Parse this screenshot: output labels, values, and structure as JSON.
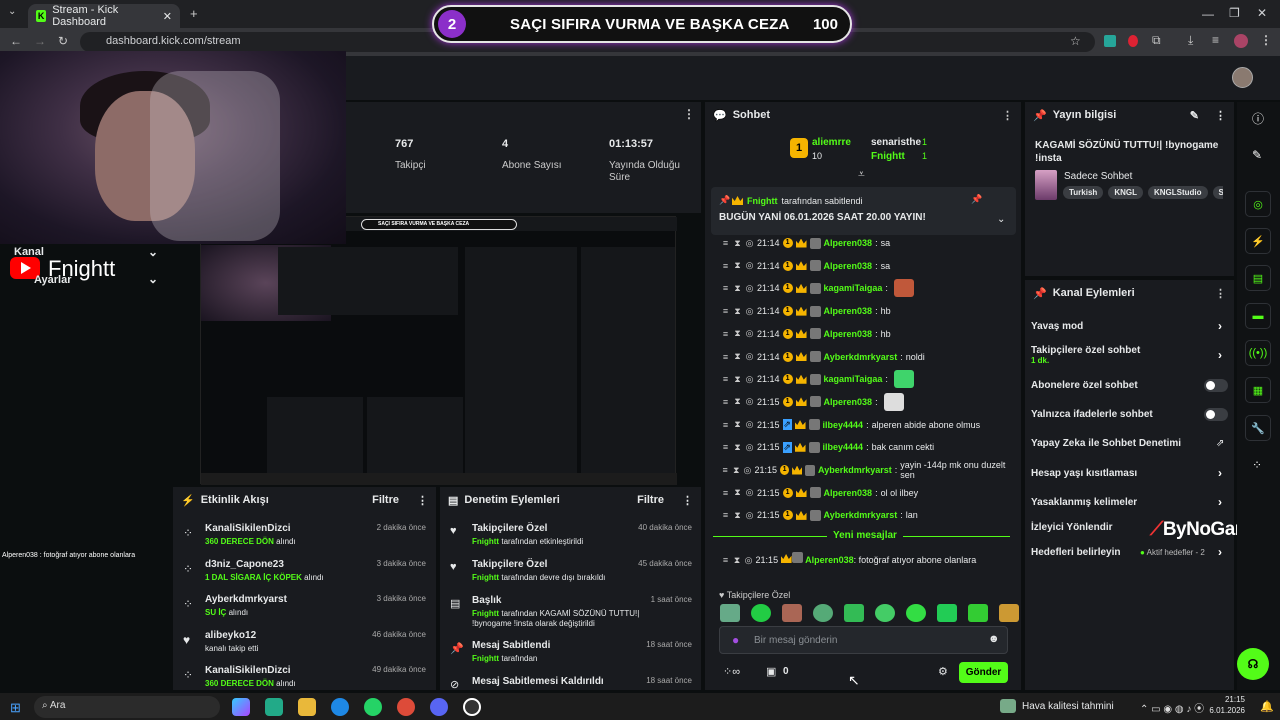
{
  "browser": {
    "tab_title": "Stream - Kick Dashboard",
    "url": "dashboard.kick.com/stream"
  },
  "banner": {
    "number": "2",
    "text": "SAÇI SIFIRA VURMA VE BAŞKA CEZA",
    "value": "100"
  },
  "stats": [
    {
      "value": "767",
      "label": "Takipçi"
    },
    {
      "value": "4",
      "label": "Abone Sayısı"
    },
    {
      "value": "01:13:57",
      "label": "Yayında Olduğu Süre"
    }
  ],
  "overlay": {
    "kanal": "Kanal",
    "ayarlar": "Ayarlar",
    "name": "Fnightt"
  },
  "side_chat_snippet": "Alperen038 : fotoğraf atıyor abone olanlara",
  "chat": {
    "title": "Sohbet",
    "top_gifters": [
      {
        "name": "aliemrre",
        "count": "10"
      },
      {
        "name": "senaristhe",
        "count": "1"
      },
      {
        "name": "Fnightt",
        "count": "1"
      }
    ],
    "pinned": {
      "user": "Fnightt",
      "suffix": "tarafından sabitlendi",
      "text": "BUGÜN YANİ 06.01.2026 SAAT 20.00 YAYIN!"
    },
    "messages": [
      {
        "time": "21:14",
        "user": "Alperen038",
        "text": "sa",
        "emote": ""
      },
      {
        "time": "21:14",
        "user": "Alperen038",
        "text": "sa",
        "emote": ""
      },
      {
        "time": "21:14",
        "user": "kagamiTaigaa",
        "text": "",
        "emote": "#c0583a"
      },
      {
        "time": "21:14",
        "user": "Alperen038",
        "text": "hb",
        "emote": ""
      },
      {
        "time": "21:14",
        "user": "Alperen038",
        "text": "hb",
        "emote": ""
      },
      {
        "time": "21:14",
        "user": "Ayberkdmrkyarst",
        "text": "noldi",
        "emote": ""
      },
      {
        "time": "21:14",
        "user": "kagamiTaigaa",
        "text": "",
        "emote": "#3fd46b"
      },
      {
        "time": "21:15",
        "user": "Alperen038",
        "text": "",
        "emote": "#dddddd"
      },
      {
        "time": "21:15",
        "user": "ilbey4444",
        "text": "alperen abide abone olmus",
        "emote": ""
      },
      {
        "time": "21:15",
        "user": "ilbey4444",
        "text": "bak canım cekti",
        "emote": ""
      },
      {
        "time": "21:15",
        "user": "Ayberkdmrkyarst",
        "text": "yayin -144p mk onu duzelt sen",
        "emote": ""
      },
      {
        "time": "21:15",
        "user": "Alperen038",
        "text": "ol ol ilbey",
        "emote": ""
      },
      {
        "time": "21:15",
        "user": "Ayberkdmrkyarst",
        "text": "lan",
        "emote": ""
      }
    ],
    "new_messages_label": "Yeni mesajlar",
    "last_message": {
      "time": "21:15",
      "user": "Alperen038",
      "text": "fotoğraf atıyor abone olanlara"
    },
    "emote_section_label": "Takipçilere Özel",
    "input_placeholder": "Bir mesaj gönderin",
    "bottom_count": "0",
    "send_label": "Gönder"
  },
  "info": {
    "title": "Yayın bilgisi",
    "stream_title": "KAGAMİ SÖZÜNÜ TUTTU!| !bynogame !insta",
    "category": "Sadece Sohbet",
    "tags": [
      "Turkish",
      "KNGL",
      "KNGLStudio",
      "So"
    ]
  },
  "actions": {
    "title": "Kanal Eylemleri",
    "items": [
      {
        "label": "Yavaş mod",
        "sub": "",
        "control": "chevron"
      },
      {
        "label": "Takipçilere özel sohbet",
        "sub": "1 dk.",
        "control": "chevron"
      },
      {
        "label": "Abonelere özel sohbet",
        "sub": "",
        "control": "toggle"
      },
      {
        "label": "Yalnızca ifadelerle sohbet",
        "sub": "",
        "control": "toggle"
      },
      {
        "label": "Yapay Zeka ile Sohbet Denetimi",
        "sub": "",
        "control": "external"
      },
      {
        "label": "Hesap yaşı kısıtlaması",
        "sub": "",
        "control": "chevron"
      },
      {
        "label": "Yasaklanmış kelimeler",
        "sub": "",
        "control": "chevron"
      },
      {
        "label": "İzleyici Yönlendir",
        "sub": "",
        "control": "none"
      },
      {
        "label": "Hedefleri belirleyin",
        "sub": "Aktif hedefler - 2",
        "control": "chevron"
      }
    ],
    "watermark": "ByNoGame"
  },
  "activity": {
    "title": "Etkinlik Akışı",
    "filter": "Filtre",
    "items": [
      {
        "user": "KanaliSikilenDizci",
        "text": "360 DERECE DÖN",
        "suffix": "alındı",
        "time": "2 dakika önce"
      },
      {
        "user": "d3niz_Capone23",
        "text": "1 DAL SİGARA İÇ KÖPEK",
        "suffix": "alındı",
        "time": "3 dakika önce"
      },
      {
        "user": "Ayberkdmrkyarst",
        "text": "SU İÇ",
        "suffix": "alındı",
        "time": "3 dakika önce"
      },
      {
        "user": "alibeyko12",
        "text": "kanalı takip etti",
        "suffix": "",
        "time": "46 dakika önce"
      },
      {
        "user": "KanaliSikilenDizci",
        "text": "360 DERECE DÖN",
        "suffix": "alındı",
        "time": "49 dakika önce"
      }
    ]
  },
  "moderation": {
    "title": "Denetim Eylemleri",
    "filter": "Filtre",
    "items": [
      {
        "title": "Takipçilere Özel",
        "user": "Fnightt",
        "text": "tarafından etkinleştirildi",
        "time": "40 dakika önce"
      },
      {
        "title": "Takipçilere Özel",
        "user": "Fnightt",
        "text": "tarafından devre dışı bırakıldı",
        "time": "45 dakika önce"
      },
      {
        "title": "Başlık",
        "user": "Fnightt",
        "text": "tarafından KAGAMİ SÖZÜNÜ TUTTU!| !bynogame !insta olarak değiştirildi",
        "time": "1 saat önce"
      },
      {
        "title": "Mesaj Sabitlendi",
        "user": "Fnightt",
        "text": "tarafından",
        "time": "18 saat önce"
      },
      {
        "title": "Mesaj Sabitlemesi Kaldırıldı",
        "user": "",
        "text": "",
        "time": "18 saat önce"
      }
    ]
  },
  "taskbar": {
    "search": "Ara",
    "weather": "Hava kalitesi tahmini",
    "time": "21:15",
    "date": "6.01.2026"
  }
}
